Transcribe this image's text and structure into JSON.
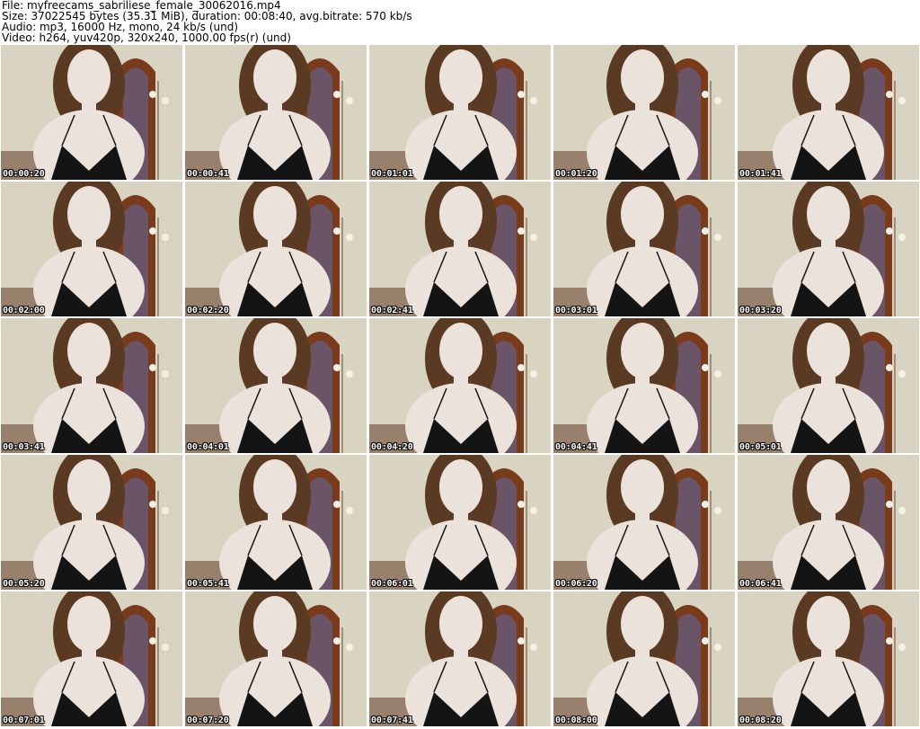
{
  "header": {
    "file_line": "File: myfreecams_sabriliese_female_30062016.mp4",
    "size_line": "Size: 37022545 bytes (35.31 MiB), duration: 00:08:40, avg.bitrate: 570 kb/s",
    "audio_line": "Audio: mp3, 16000 Hz, mono, 24 kb/s (und)",
    "video_line": "Video: h264, yuv420p, 320x240, 1000.00 fps(r) (und)"
  },
  "thumbnails": [
    {
      "time": "00:00:20"
    },
    {
      "time": "00:00:41"
    },
    {
      "time": "00:01:01"
    },
    {
      "time": "00:01:20"
    },
    {
      "time": "00:01:41"
    },
    {
      "time": "00:02:00"
    },
    {
      "time": "00:02:20"
    },
    {
      "time": "00:02:41"
    },
    {
      "time": "00:03:01"
    },
    {
      "time": "00:03:20"
    },
    {
      "time": "00:03:41"
    },
    {
      "time": "00:04:01"
    },
    {
      "time": "00:04:20"
    },
    {
      "time": "00:04:41"
    },
    {
      "time": "00:05:01"
    },
    {
      "time": "00:05:20"
    },
    {
      "time": "00:05:41"
    },
    {
      "time": "00:06:01"
    },
    {
      "time": "00:06:20"
    },
    {
      "time": "00:06:41"
    },
    {
      "time": "00:07:01"
    },
    {
      "time": "00:07:20"
    },
    {
      "time": "00:07:41"
    },
    {
      "time": "00:08:00"
    },
    {
      "time": "00:08:20"
    }
  ],
  "colors": {
    "wall": "#d9d4c2",
    "door": "#7a3a1c",
    "window": "#5b6aa8",
    "hair": "#5a3a22",
    "skin": "#ece2dc",
    "top": "#141414",
    "floor": "#6b4a32"
  }
}
